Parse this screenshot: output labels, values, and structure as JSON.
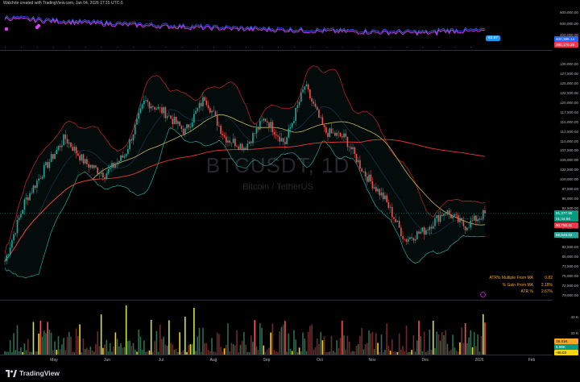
{
  "header": {
    "caption": "Walchrle created with TradingView.com, Jan 04, 2026 17:15 UTC-5"
  },
  "watermark": {
    "symbol": "BTCUSDT, 1D",
    "description": "Bitcoin / TetherUS"
  },
  "top_axis": {
    "ticks": [
      "600,000.00",
      "500,000.00",
      "400,000.00",
      "300,000.00"
    ]
  },
  "top_tags": [
    {
      "text": "400,389.14",
      "color": "#2962ff"
    },
    {
      "text": "390,170.28",
      "color": "#f23645"
    }
  ],
  "top_badge": {
    "text": "83.67",
    "color": "#2196f3"
  },
  "main_axis": {
    "ticks": [
      "130,000.00",
      "127,500.00",
      "125,000.00",
      "122,500.00",
      "120,000.00",
      "117,500.00",
      "115,000.00",
      "112,500.00",
      "110,000.00",
      "107,500.00",
      "105,000.00",
      "102,500.00",
      "100,000.00",
      "97,500.00",
      "95,000.00",
      "92,500.00",
      "90,000.00",
      "87,500.00",
      "85,000.00",
      "82,500.00",
      "80,000.00",
      "77,500.00",
      "75,000.00",
      "72,500.00",
      "70,000.00"
    ]
  },
  "price_tags": [
    {
      "text": "91,377.96",
      "color": "#089981"
    },
    {
      "text": "01:44:56",
      "color": "#089981"
    },
    {
      "text": "90,750.11",
      "color": "#f23645"
    },
    {
      "text": "85,549.02",
      "color": "#26a69a"
    }
  ],
  "info_table": [
    {
      "label": "ATR% Multiple From MA",
      "value": "0.82"
    },
    {
      "label": "% Gain From MA",
      "value": "2.18%"
    },
    {
      "label": "ATR %",
      "value": "2.67%"
    }
  ],
  "vol_axis": {
    "ticks": [
      "40 K",
      "20 K"
    ]
  },
  "vol_tags": [
    {
      "text": "18.41K",
      "color": "#f5a623"
    },
    {
      "text": "5.96K",
      "color": "#089981"
    },
    {
      "text": "-46.03",
      "color": "#f5d50b"
    }
  ],
  "x_axis": {
    "labels": [
      "May",
      "Jun",
      "Jul",
      "Aug",
      "Sep",
      "Oct",
      "Nov",
      "Dec",
      "2026",
      "Feb"
    ]
  },
  "footer": {
    "brand": "TradingView"
  },
  "colors": {
    "up": "#26a69a",
    "down": "#ef5350",
    "bb_upper": "#c62828",
    "bb_lower": "#26a69a",
    "ma_red": "#e53935",
    "ma_yellow": "#c9b458",
    "ma_blue": "#2962ff",
    "accent_purple": "#e040fb"
  },
  "chart_data": {
    "type": "candlestick",
    "symbol": "BTCUSDT, 1D",
    "ylim": [
      70000,
      131000
    ],
    "x_range": [
      "Apr 2025",
      "Feb 2026"
    ],
    "price_monthly_anchors": {
      "x": [
        "Apr 10",
        "Apr 25",
        "May 10",
        "May 22",
        "Jun 5",
        "Jun 22",
        "Jul 1",
        "Jul 14",
        "Jul 25",
        "Aug 3",
        "Aug 14",
        "Aug 25",
        "Sep 1",
        "Sep 15",
        "Sep 25",
        "Oct 6",
        "Oct 11",
        "Oct 25",
        "Nov 5",
        "Nov 15",
        "Nov 21",
        "Dec 1",
        "Dec 10",
        "Dec 20",
        "Jan 4"
      ],
      "close": [
        79000,
        94500,
        103000,
        111000,
        104500,
        101500,
        106500,
        120500,
        117500,
        112500,
        121500,
        111000,
        108500,
        116000,
        109500,
        124500,
        112500,
        111000,
        101500,
        95000,
        84500,
        87000,
        92000,
        88000,
        91377.96
      ]
    },
    "ma_long_end": 107500,
    "ma_mid_end": 90750.11
  }
}
